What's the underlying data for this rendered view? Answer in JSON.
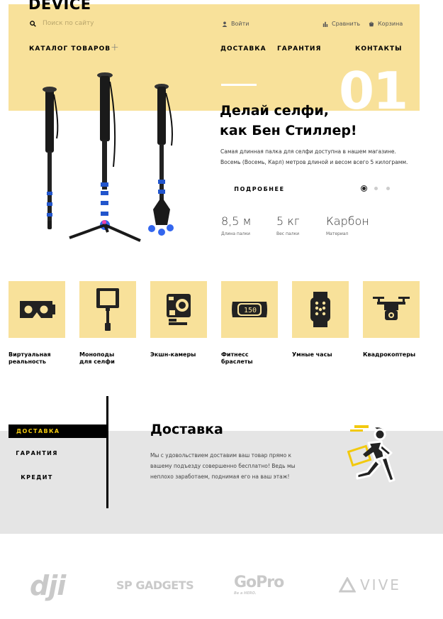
{
  "header": {
    "logo": "DEVICE",
    "search_placeholder": "Поиск по сайту",
    "login": "Войти",
    "compare": "Сравнить",
    "cart": "Корзина",
    "catalog": "КАТАЛОГ ТОВАРОВ",
    "catalog_plus": "+",
    "nav": [
      "ДОСТАВКА",
      "ГАРАНТИЯ",
      "КОНТАКТЫ"
    ]
  },
  "slider": {
    "number": "01",
    "title_line1": "Делай селфи,",
    "title_line2": "как Бен Стиллер!",
    "desc_line1": "Самая длинная палка для селфи доступна в нашем магазине.",
    "desc_line2": "Восемь (Восемь, Карл) метров длиной и весом всего 5 килограмм.",
    "more": "ПОДРОБНЕЕ",
    "dots": 3,
    "active_dot": 1,
    "specs": [
      {
        "value": "8,5 м",
        "label": "Длина палки"
      },
      {
        "value": "5 кг",
        "label": "Вес палки"
      },
      {
        "value": "Карбон",
        "label": "Материал"
      }
    ]
  },
  "categories": [
    {
      "name": "Виртуальная\nреальность",
      "icon": "vr-headset-icon"
    },
    {
      "name": "Моноподы\nдля селфи",
      "icon": "selfie-stick-icon"
    },
    {
      "name": "Экшн-камеры",
      "icon": "action-camera-icon"
    },
    {
      "name": "Фитнесс\nбраслеты",
      "icon": "fitness-band-icon",
      "screen_text": "150"
    },
    {
      "name": "Умные часы",
      "icon": "smartwatch-icon"
    },
    {
      "name": "Квадрокоптеры",
      "icon": "drone-icon"
    }
  ],
  "services": {
    "tabs": [
      "ДОСТАВКА",
      "ГАРАНТИЯ",
      "КРЕДИТ"
    ],
    "active_tab": 0,
    "title": "Доставка",
    "text": "Мы с удовольствием доставим ваш товар прямо к вашему подъезду совершенно бесплатно! Ведь мы неплохо заработаем, поднимая его на ваш этаж!",
    "illustration": "courier-icon"
  },
  "brands": [
    "dji",
    "SP GADGETS",
    "GoPro",
    "VIVE"
  ],
  "brand_sublabels": {
    "gopro": "Be a HERO."
  },
  "colors": {
    "accent": "#f8e19a",
    "yellow": "#f2c90e",
    "dark": "#000000",
    "gray_band": "#e5e5e5",
    "brand_gray": "#c9c9c9"
  }
}
